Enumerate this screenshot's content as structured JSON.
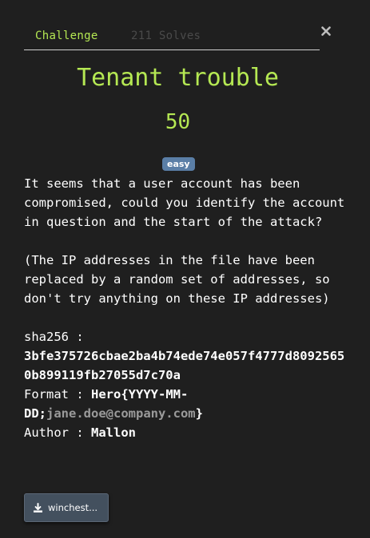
{
  "tabs": {
    "challenge_label": "Challenge",
    "solves_label": "211 Solves"
  },
  "close_icon": "close-icon",
  "challenge": {
    "title": "Tenant trouble",
    "value": "50",
    "difficulty": "easy",
    "description_1": "It seems that a user account has been compromised, could you identify the account in question and the start of the attack?",
    "description_2": "(The IP addresses in the file have been replaced by a random set of addresses, so don't try anything on these IP addresses)",
    "sha_label": "sha256 :",
    "sha_value": "3bfe375726cbae2ba4b74ede74e057f4777d80925650b899119fb27055d7c70a",
    "format_label": "Format : ",
    "format_prefix": "Hero{YYYY-MM-DD;",
    "format_email": "jane.doe@company.com",
    "format_suffix": "}",
    "author_label": "Author : ",
    "author_name": "Mallon"
  },
  "download": {
    "icon": "download-icon",
    "label": "winchest..."
  },
  "colors": {
    "background": "#1f1f1f",
    "accent": "#b5e853",
    "badge": "#5a7ea6",
    "button": "#43505e"
  }
}
